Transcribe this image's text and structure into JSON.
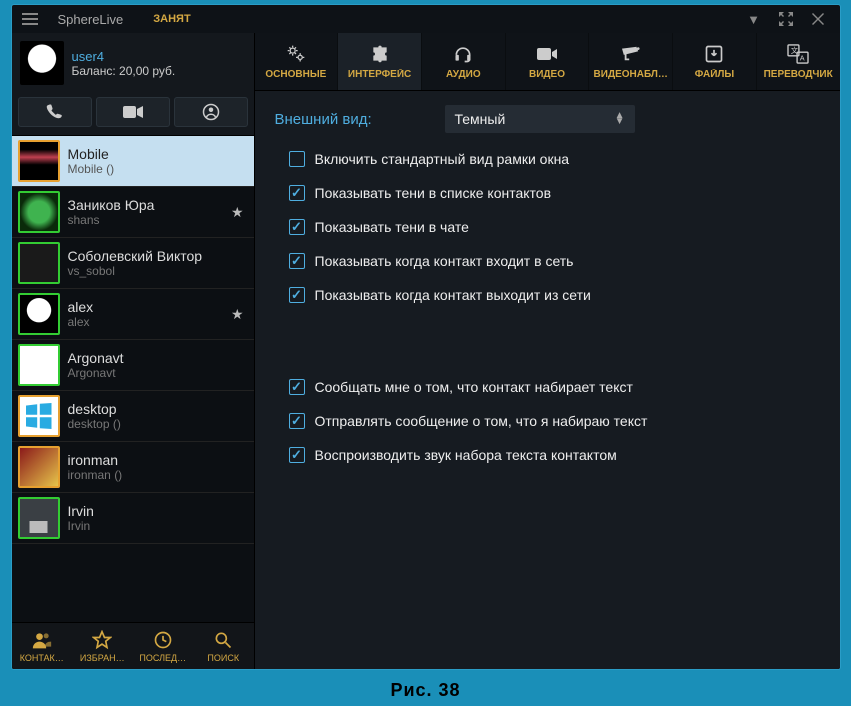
{
  "titlebar": {
    "app": "SphereLive",
    "status": "ЗАНЯТ"
  },
  "user": {
    "name": "user4",
    "balance": "Баланс: 20,00 руб."
  },
  "contacts": [
    {
      "name": "Mobile",
      "sub": "Mobile ()",
      "selected": true,
      "avatar": "av-mobile",
      "star": false,
      "border": "orange"
    },
    {
      "name": "Заников Юра",
      "sub": "shans",
      "avatar": "av-green",
      "star": true,
      "border": "green"
    },
    {
      "name": "Соболевский Виктор",
      "sub": "vs_sobol",
      "avatar": "av-dark",
      "star": false,
      "border": "green"
    },
    {
      "name": "alex",
      "sub": "alex",
      "avatar": "av-panda",
      "star": true,
      "border": "green"
    },
    {
      "name": "Argonavt",
      "sub": "Argonavt",
      "avatar": "av-white",
      "star": false,
      "border": "green"
    },
    {
      "name": "desktop",
      "sub": "desktop ()",
      "avatar": "av-windows",
      "star": false,
      "border": "orange"
    },
    {
      "name": "ironman",
      "sub": "ironman ()",
      "avatar": "av-iron",
      "star": false,
      "border": "orange"
    },
    {
      "name": "Irvin",
      "sub": "Irvin",
      "avatar": "av-user",
      "star": false,
      "border": "green"
    }
  ],
  "bottom_tabs": [
    {
      "label": "КОНТАК…",
      "icon": "contacts"
    },
    {
      "label": "ИЗБРАН…",
      "icon": "star"
    },
    {
      "label": "ПОСЛЕД…",
      "icon": "clock"
    },
    {
      "label": "ПОИСК",
      "icon": "search"
    }
  ],
  "settings_tabs": [
    {
      "label": "ОСНОВНЫЕ",
      "icon": "gears"
    },
    {
      "label": "ИНТЕРФЕЙС",
      "icon": "puzzle",
      "active": true
    },
    {
      "label": "АУДИО",
      "icon": "headset"
    },
    {
      "label": "ВИДЕО",
      "icon": "camera"
    },
    {
      "label": "ВИДЕОНАБЛ…",
      "icon": "cctv"
    },
    {
      "label": "ФАЙЛЫ",
      "icon": "download"
    },
    {
      "label": "ПЕРЕВОДЧИК",
      "icon": "translate"
    }
  ],
  "form": {
    "theme_label": "Внешний вид:",
    "theme_value": "Темный"
  },
  "checks": [
    {
      "label": "Включить стандартный вид рамки окна",
      "checked": false
    },
    {
      "label": "Показывать тени в списке контактов",
      "checked": true
    },
    {
      "label": "Показывать тени в чате",
      "checked": true
    },
    {
      "label": "Показывать когда контакт входит в сеть",
      "checked": true
    },
    {
      "label": "Показывать когда контакт выходит из сети",
      "checked": true
    }
  ],
  "checks2": [
    {
      "label": "Сообщать мне о том, что контакт набирает текст",
      "checked": true
    },
    {
      "label": "Отправлять сообщение о том, что я набираю текст",
      "checked": true
    },
    {
      "label": "Воспроизводить звук набора текста контактом",
      "checked": true
    }
  ],
  "caption": "Рис. 38"
}
